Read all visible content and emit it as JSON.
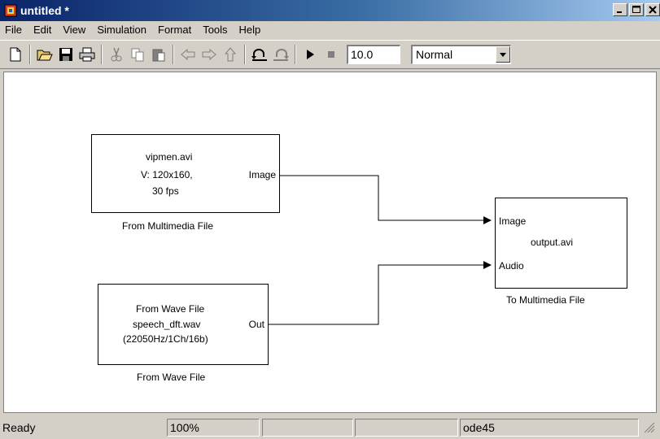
{
  "window": {
    "title": "untitled *"
  },
  "menu": [
    "File",
    "Edit",
    "View",
    "Simulation",
    "Format",
    "Tools",
    "Help"
  ],
  "toolbar": {
    "stop_time": "10.0",
    "sim_mode": "Normal",
    "icons": [
      "new-icon",
      "open-icon",
      "save-icon",
      "print-icon",
      "cut-icon",
      "copy-icon",
      "paste-icon",
      "back-icon",
      "forward-icon",
      "up-icon",
      "undo-icon",
      "redo-icon",
      "play-icon",
      "stop-icon"
    ]
  },
  "blocks": {
    "from_multimedia": {
      "lines": [
        "vipmen.avi",
        "V: 120x160,",
        "30 fps"
      ],
      "port_out": "Image",
      "caption": "From Multimedia File"
    },
    "from_wave": {
      "lines": [
        "From Wave File",
        "speech_dft.wav",
        "(22050Hz/1Ch/16b)"
      ],
      "port_out": "Out",
      "caption": "From Wave File"
    },
    "to_multimedia": {
      "port_in_1": "Image",
      "port_in_2": "Audio",
      "label": "output.avi",
      "caption": "To Multimedia File"
    }
  },
  "status": {
    "left": "Ready",
    "zoom": "100%",
    "solver": "ode45"
  }
}
